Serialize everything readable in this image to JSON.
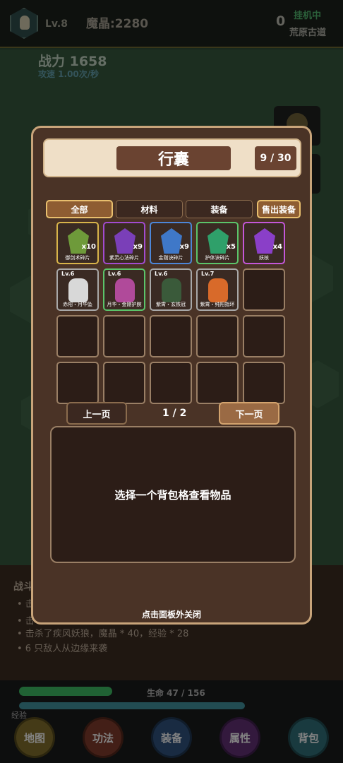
{
  "header": {
    "level": "Lv.8",
    "crystal": "魔晶:2280",
    "counter": "0",
    "status": "挂机中",
    "zone": "荒原古道"
  },
  "stats": {
    "power": "战力 1658",
    "attack_speed": "攻速 1.00次/秒"
  },
  "log": {
    "title": "战斗",
    "lines": [
      "•  击",
      "•  击",
      "•  击杀了疾风妖狼，魔晶 * 40，经验 * 28",
      "•  6 只敌人从边缘来袭"
    ]
  },
  "bars": {
    "hp_text": "生命 47 / 156",
    "hp_fraction": 0.3,
    "exp_label": "经验"
  },
  "nav": [
    {
      "label": "地图",
      "color": "#7d6b2a"
    },
    {
      "label": "功法",
      "color": "#7a3a2a"
    },
    {
      "label": "装备",
      "color": "#2e4f78"
    },
    {
      "label": "属性",
      "color": "#5d2e70"
    },
    {
      "label": "背包",
      "color": "#2f6a73"
    }
  ],
  "bag": {
    "title": "行囊",
    "capacity": "9 / 30",
    "tabs": {
      "all": "全部",
      "material": "材料",
      "equipment": "装备",
      "sell": "售出装备"
    },
    "items": [
      {
        "name": "御剑术碎片",
        "count": "x10",
        "rarity": "#d8b44a",
        "color": "#6e9a3a"
      },
      {
        "name": "紫灵心法碎片",
        "count": "x9",
        "rarity": "#a24bd0",
        "color": "#7a3fb8"
      },
      {
        "name": "金刚诀碎片",
        "count": "x9",
        "rarity": "#4c86d8",
        "color": "#3f78c8"
      },
      {
        "name": "护体诀碎片",
        "count": "x5",
        "rarity": "#5bc46a",
        "color": "#2fa06a"
      },
      {
        "name": "妖核",
        "count": "x4",
        "rarity": "#c457d8",
        "color": "#8a3fc8"
      },
      {
        "name": "赤阳・月华坠",
        "level": "Lv.6",
        "rarity": "#a8a8a8",
        "color": "#d8d8d8"
      },
      {
        "name": "月华・金刚护腕",
        "level": "Lv.6",
        "rarity": "#5bc46a",
        "color": "#b04a9a"
      },
      {
        "name": "紫霄・玄铁冠",
        "level": "Lv.6",
        "rarity": "#a8a8a8",
        "color": "#3a5a3a"
      },
      {
        "name": "紫霄・纯阳指环",
        "level": "Lv.7",
        "rarity": "#a8a8a8",
        "color": "#d86a2a"
      }
    ],
    "prev": "上一页",
    "page": "1 / 2",
    "next": "下一页",
    "detail_hint": "选择一个背包格查看物品",
    "close_hint": "点击面板外关闭"
  }
}
